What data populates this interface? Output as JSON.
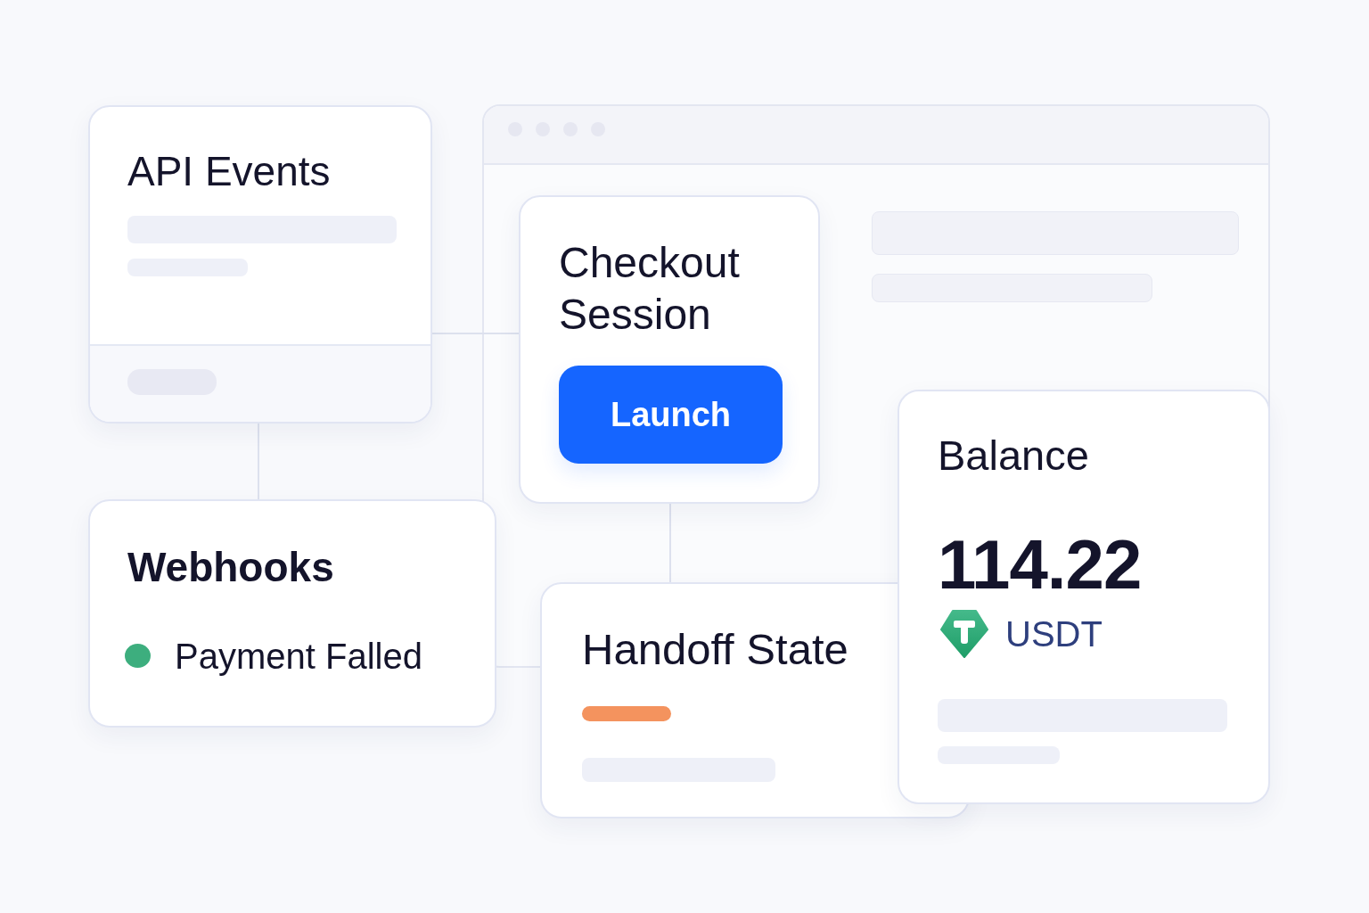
{
  "api_events": {
    "title": "API Events"
  },
  "checkout_session": {
    "title": "Checkout Session",
    "button": "Launch"
  },
  "balance": {
    "title": "Balance",
    "amount": "114.22",
    "currency": "USDT"
  },
  "webhooks": {
    "title": "Webhooks",
    "events": [
      {
        "label": "Payment Falled",
        "color": "#3dae7e"
      }
    ]
  },
  "handoff_state": {
    "title": "Handoff State"
  }
}
